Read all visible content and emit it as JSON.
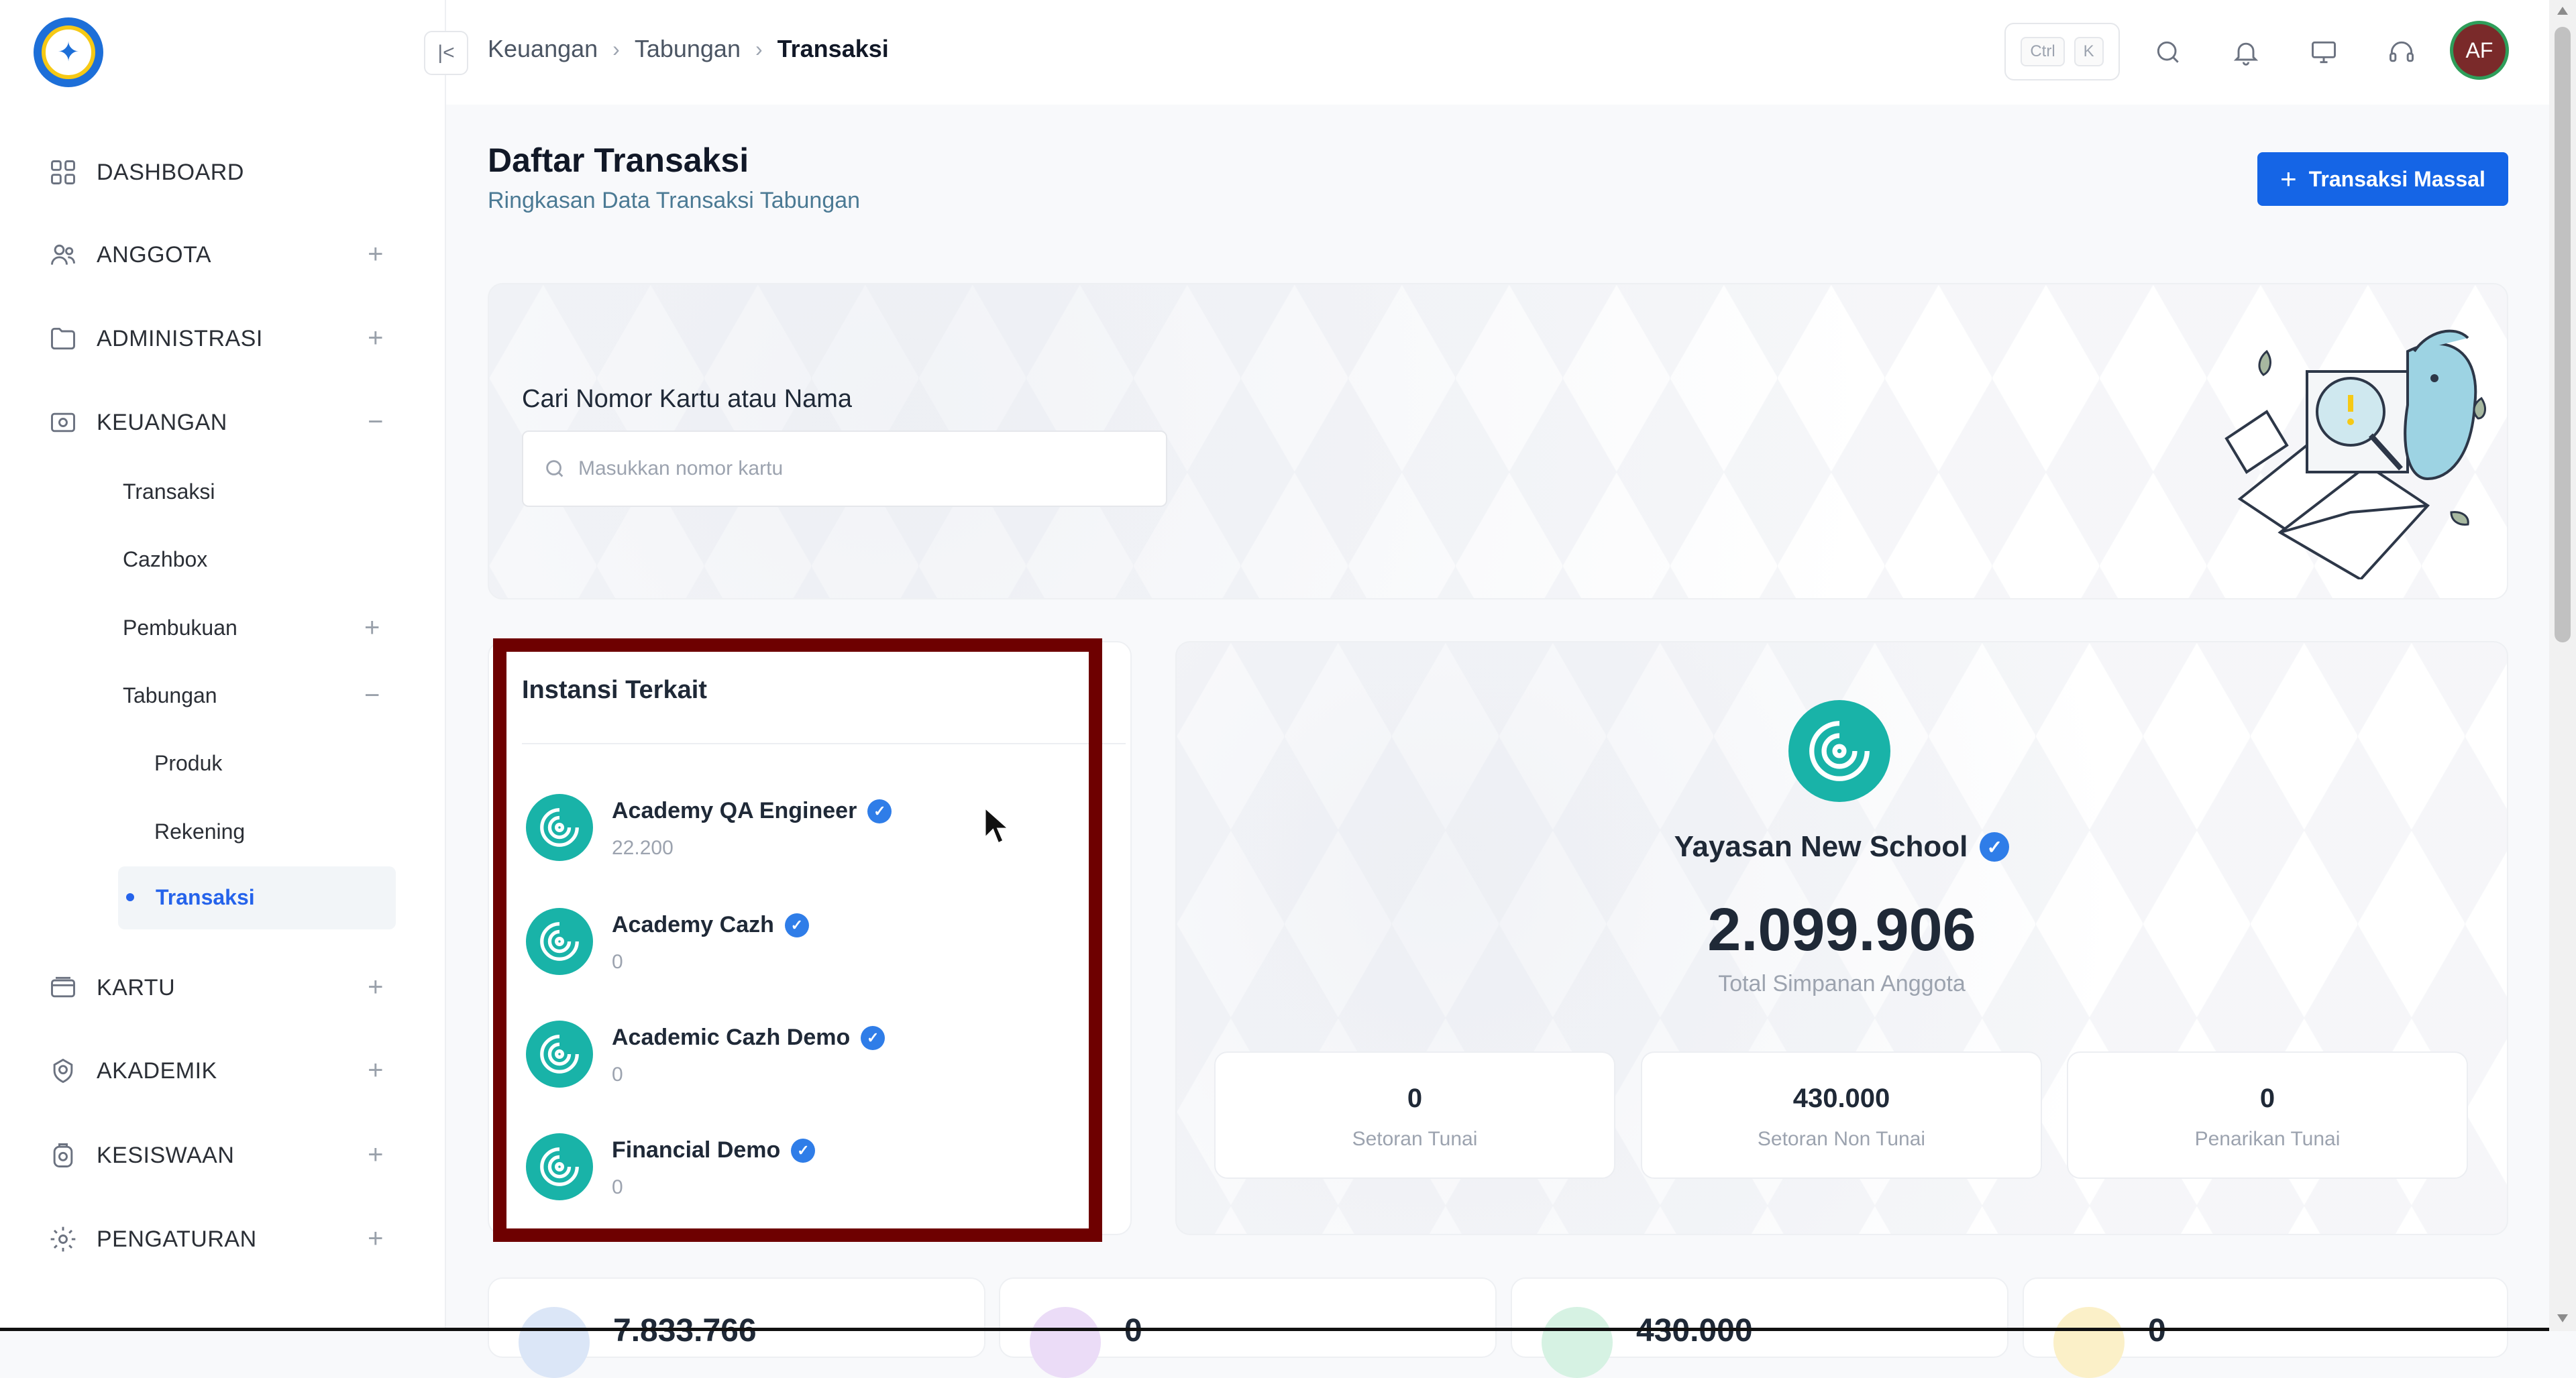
{
  "breadcrumb": {
    "items": [
      "Keuangan",
      "Tabungan"
    ],
    "current": "Transaksi"
  },
  "shortcut": {
    "key1": "Ctrl",
    "key2": "K"
  },
  "user": {
    "initials": "AF"
  },
  "sidebar": {
    "dashboard": "DASHBOARD",
    "anggota": "ANGGOTA",
    "administrasi": "ADMINISTRASI",
    "keuangan": "KEUANGAN",
    "keuangan_sub": {
      "transaksi": "Transaksi",
      "cazhbox": "Cazhbox",
      "pembukuan": "Pembukuan",
      "tabungan": "Tabungan"
    },
    "tabungan_sub": {
      "produk": "Produk",
      "rekening": "Rekening",
      "transaksi": "Transaksi"
    },
    "kartu": "KARTU",
    "akademik": "AKADEMIK",
    "kesiswaan": "KESISWAAN",
    "pengaturan": "PENGATURAN",
    "expand_symbol": "+",
    "collapse_symbol": "−"
  },
  "page": {
    "title": "Daftar Transaksi",
    "subtitle": "Ringkasan Data Transaksi Tabungan",
    "bulk_button": "Transaksi Massal"
  },
  "search": {
    "label": "Cari Nomor Kartu atau Nama",
    "placeholder": "Masukkan nomor kartu"
  },
  "instansi": {
    "title": "Instansi Terkait",
    "items": [
      {
        "name": "Academy QA Engineer",
        "value": "22.200"
      },
      {
        "name": "Academy Cazh",
        "value": "0"
      },
      {
        "name": "Academic Cazh Demo",
        "value": "0"
      },
      {
        "name": "Financial Demo",
        "value": "0"
      }
    ]
  },
  "summary": {
    "name": "Yayasan New School",
    "total": "2.099.906",
    "total_label": "Total Simpanan Anggota",
    "stats": [
      {
        "value": "0",
        "label": "Setoran Tunai"
      },
      {
        "value": "430.000",
        "label": "Setoran Non Tunai"
      },
      {
        "value": "0",
        "label": "Penarikan Tunai"
      }
    ]
  },
  "bottom_cards": [
    "7.833.766",
    "0",
    "430.000",
    "0"
  ],
  "colors": {
    "primary": "#1565e6",
    "teal": "#19b3a8",
    "highlight_frame": "#6e0000",
    "verified": "#2f7de8"
  }
}
